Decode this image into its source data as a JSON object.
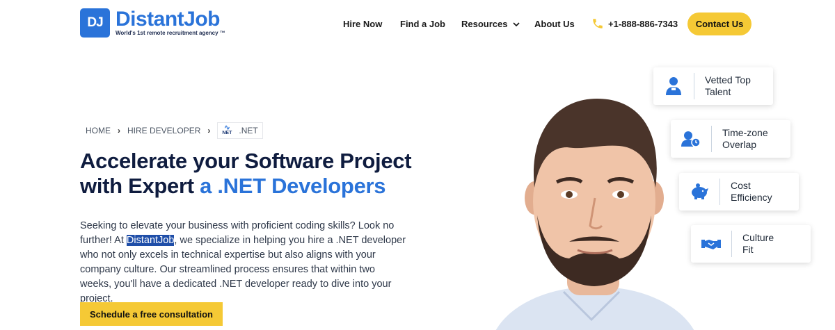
{
  "header": {
    "logo_mark": "DJ",
    "logo_name": "DistantJob",
    "logo_tagline": "World's 1st remote recruitment agency ™",
    "nav": {
      "hire_now": "Hire Now",
      "find_job": "Find a Job",
      "resources": "Resources",
      "about": "About Us"
    },
    "phone": "+1-888-886-7343",
    "contact_label": "Contact Us"
  },
  "breadcrumb": {
    "home": "HOME",
    "hire_developer": "HIRE DEVELOPER",
    "current": ".NET",
    "chip_icon_text": "NET"
  },
  "hero": {
    "headline_line1": "Accelerate your Software Project",
    "headline_line2_prefix": "with Expert ",
    "headline_line2_accent": "a .NET Developers",
    "desc_before": "Seeking to elevate your business with proficient coding skills? Look no further! At ",
    "desc_highlight": "DistantJob",
    "desc_after": ", we specialize in helping you hire a .NET developer who not only excels in technical expertise but also aligns with your company culture. Our streamlined process ensures that within two weeks, you'll have a dedicated .NET developer ready to dive into your project.",
    "cta_label": "Schedule a free consultation"
  },
  "features": [
    {
      "line1": "Vetted Top",
      "line2": "Talent",
      "icon": "person-badge-icon"
    },
    {
      "line1": "Time-zone",
      "line2": "Overlap",
      "icon": "user-clock-icon"
    },
    {
      "line1": "Cost",
      "line2": "Efficiency",
      "icon": "piggy-bank-icon"
    },
    {
      "line1": "Culture",
      "line2": "Fit",
      "icon": "handshake-icon"
    }
  ],
  "colors": {
    "brand_blue": "#2a73d9",
    "navy": "#0f1c3f",
    "accent_yellow": "#f5c935"
  }
}
